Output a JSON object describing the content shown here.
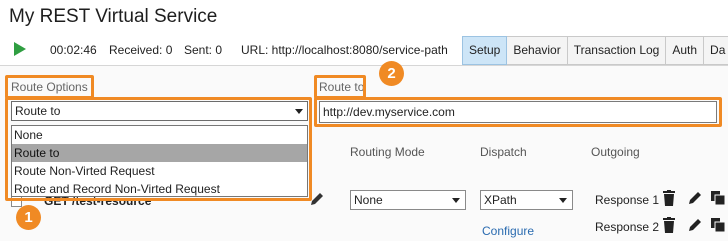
{
  "window": {
    "title": "My REST Virtual Service"
  },
  "status": {
    "elapsed": "00:02:46",
    "received": "Received: 0",
    "sent": "Sent: 0",
    "url": "URL: http://localhost:8080/service-path"
  },
  "tabs": [
    {
      "label": "Setup",
      "active": true
    },
    {
      "label": "Behavior"
    },
    {
      "label": "Transaction Log"
    },
    {
      "label": "Auth"
    },
    {
      "label": "Da"
    }
  ],
  "route_options": {
    "label": "Route Options",
    "selected": "Route to",
    "options": [
      "None",
      "Route to",
      "Route Non-Virted Request",
      "Route and Record Non-Virted Request"
    ],
    "highlighted_index": 1
  },
  "route_to": {
    "label": "Route to",
    "value": "http://dev.myservice.com"
  },
  "callouts": [
    "1",
    "2"
  ],
  "table": {
    "headers": {
      "routing_mode": "Routing Mode",
      "dispatch": "Dispatch",
      "outgoing": "Outgoing"
    },
    "row": {
      "resource": "GET /test-resource",
      "routing_mode": "None",
      "dispatch": "XPath",
      "configure": "Configure",
      "responses": [
        "Response 1",
        "Response 2"
      ]
    }
  },
  "colors": {
    "accent": "#f08a24",
    "play": "#2f9e41",
    "active_tab": "#cde5f7",
    "link": "#2a6bb0"
  }
}
